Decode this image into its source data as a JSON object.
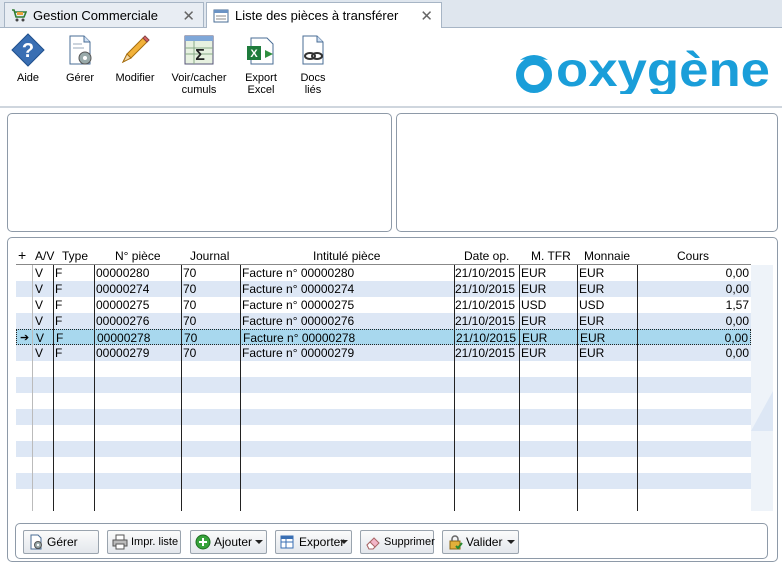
{
  "tabs": [
    {
      "label": "Gestion Commerciale",
      "icon": "cart-icon"
    },
    {
      "label": "Liste des pièces à transférer",
      "icon": "list-window-icon"
    }
  ],
  "toolbar": {
    "aide": "Aide",
    "gerer": "Gérer",
    "modifier": "Modifier",
    "voir_line1": "Voir/cacher",
    "voir_line2": "cumuls",
    "export_line1": "Export",
    "export_line2": "Excel",
    "docs_line1": "Docs",
    "docs_line2": "liés"
  },
  "logo": {
    "text": "oxygène",
    "color": "#1a9ed9"
  },
  "grid": {
    "columns": [
      "A/V",
      "Type",
      "N° pièce",
      "Journal",
      "Intitulé pièce",
      "Date op.",
      "M. TFR",
      "Monnaie",
      "Cours"
    ],
    "rows": [
      {
        "av": "V",
        "type": "F",
        "num": "00000280",
        "journal": "70",
        "intitule": "Facture n° 00000280",
        "date": "21/10/2015",
        "mtfr": "EUR",
        "monnaie": "EUR",
        "cours": "0,00"
      },
      {
        "av": "V",
        "type": "F",
        "num": "00000274",
        "journal": "70",
        "intitule": "Facture n° 00000274",
        "date": "21/10/2015",
        "mtfr": "EUR",
        "monnaie": "EUR",
        "cours": "0,00"
      },
      {
        "av": "V",
        "type": "F",
        "num": "00000275",
        "journal": "70",
        "intitule": "Facture n° 00000275",
        "date": "21/10/2015",
        "mtfr": "USD",
        "monnaie": "USD",
        "cours": "1,57"
      },
      {
        "av": "V",
        "type": "F",
        "num": "00000276",
        "journal": "70",
        "intitule": "Facture n° 00000276",
        "date": "21/10/2015",
        "mtfr": "EUR",
        "monnaie": "EUR",
        "cours": "0,00"
      },
      {
        "av": "V",
        "type": "F",
        "num": "00000278",
        "journal": "70",
        "intitule": "Facture n° 00000278",
        "date": "21/10/2015",
        "mtfr": "EUR",
        "monnaie": "EUR",
        "cours": "0,00"
      },
      {
        "av": "V",
        "type": "F",
        "num": "00000279",
        "journal": "70",
        "intitule": "Facture n° 00000279",
        "date": "21/10/2015",
        "mtfr": "EUR",
        "monnaie": "EUR",
        "cours": "0,00"
      }
    ],
    "selected_index": 4
  },
  "buttons": {
    "gerer": "Gérer",
    "impr": "Impr. liste",
    "ajouter": "Ajouter",
    "exporter": "Exporter",
    "supprimer": "Supprimer",
    "valider": "Valider"
  }
}
